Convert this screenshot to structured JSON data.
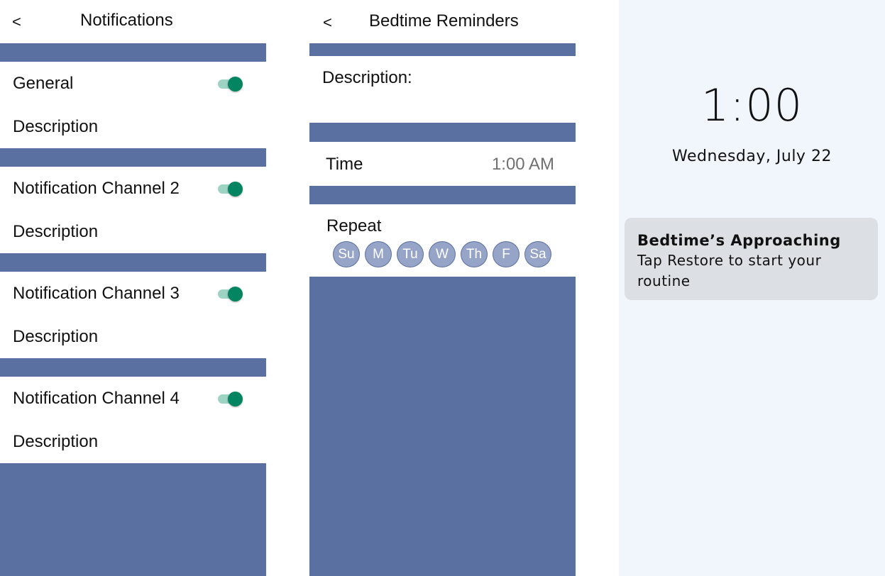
{
  "notifications_screen": {
    "back_label": "<",
    "title": "Notifications",
    "channels": [
      {
        "name": "General",
        "description": "Description",
        "enabled": true
      },
      {
        "name": "Notification Channel 2",
        "description": "Description",
        "enabled": true
      },
      {
        "name": "Notification Channel 3",
        "description": "Description",
        "enabled": true
      },
      {
        "name": "Notification Channel 4",
        "description": "Description",
        "enabled": true
      }
    ]
  },
  "bedtime_screen": {
    "back_label": "<",
    "title": "Bedtime Reminders",
    "description_label": "Description:",
    "time_label": "Time",
    "time_value": "1:00 AM",
    "repeat_label": "Repeat",
    "days": [
      "Su",
      "M",
      "Tu",
      "W",
      "Th",
      "F",
      "Sa"
    ]
  },
  "lock_screen": {
    "time": "1:00",
    "date": "Wednesday, July 22",
    "notification": {
      "title": "Bedtime’s Approaching",
      "body": "Tap Restore to start your routine"
    }
  },
  "colors": {
    "separator": "#5a70a0",
    "toggle_on": "#048562",
    "toggle_track": "#9dd3c2",
    "day_chip": "#96a4c8",
    "lock_bg": "#f1f6fd",
    "notification_bg": "#dcdfe4"
  }
}
